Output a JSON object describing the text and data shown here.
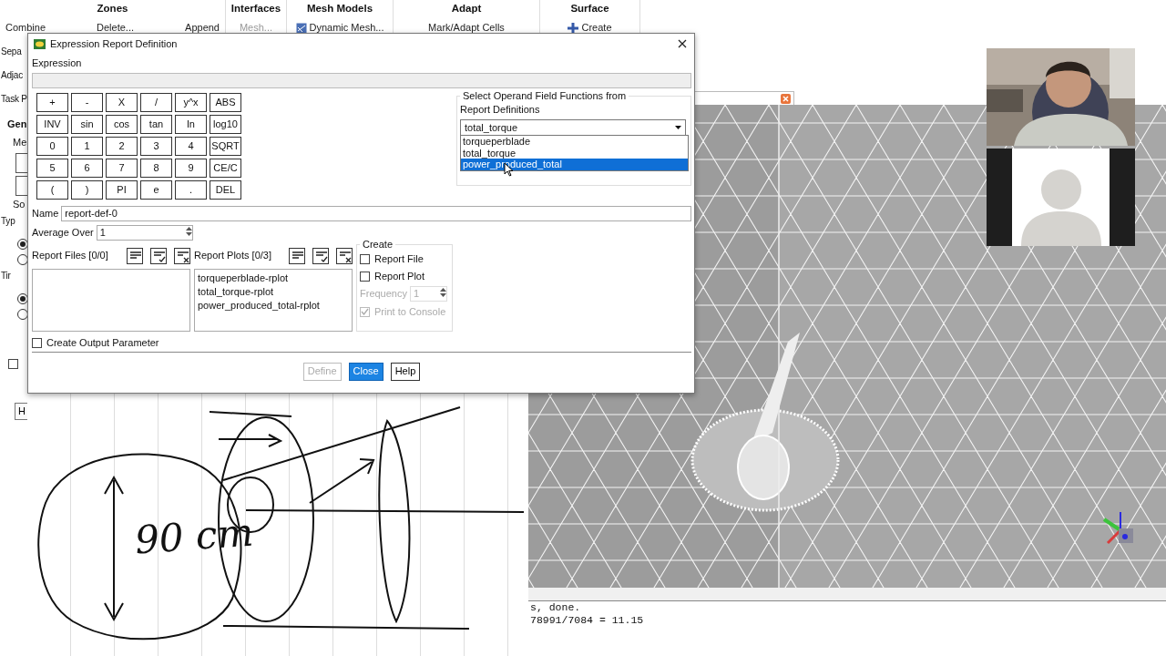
{
  "ribbon": {
    "groups": [
      {
        "title": "Zones",
        "items": [
          {
            "label": "Combine",
            "disabled": false
          },
          {
            "label": "Delete...",
            "disabled": false
          },
          {
            "label": "Append",
            "disabled": false
          }
        ]
      },
      {
        "title": "Interfaces",
        "items": [
          {
            "label": "Mesh...",
            "disabled": true
          }
        ]
      },
      {
        "title": "Mesh Models",
        "items": [
          {
            "label": "Dynamic Mesh...",
            "disabled": false,
            "kind": "mesh"
          }
        ]
      },
      {
        "title": "Adapt",
        "items": [
          {
            "label": "Mark/Adapt Cells",
            "disabled": false
          }
        ]
      },
      {
        "title": "Surface",
        "items": [
          {
            "label": "Create",
            "disabled": false,
            "kind": "plus"
          }
        ]
      }
    ]
  },
  "task_panel": {
    "items": [
      {
        "kind": "text",
        "label": "Sepa"
      },
      {
        "kind": "text",
        "label": "Adjac"
      },
      {
        "kind": "text",
        "label": "Task P"
      },
      {
        "kind": "heading",
        "label": "Gen"
      },
      {
        "kind": "group",
        "label": "Me"
      },
      {
        "kind": "box"
      },
      {
        "kind": "box"
      },
      {
        "kind": "group",
        "label": "So"
      },
      {
        "kind": "text",
        "label": "Typ"
      },
      {
        "kind": "radio",
        "selected": true
      },
      {
        "kind": "radio",
        "selected": false
      },
      {
        "kind": "text",
        "label": "Tir"
      },
      {
        "kind": "radio",
        "selected": true
      },
      {
        "kind": "radio",
        "selected": false
      },
      {
        "kind": "check",
        "checked": false
      },
      {
        "kind": "button",
        "label": "H"
      }
    ]
  },
  "dialog": {
    "title": "Expression Report Definition",
    "expression_label": "Expression",
    "keypad": [
      [
        "+",
        "-",
        "X",
        "/",
        "y^x",
        "ABS"
      ],
      [
        "INV",
        "sin",
        "cos",
        "tan",
        "ln",
        "log10"
      ],
      [
        "0",
        "1",
        "2",
        "3",
        "4",
        "SQRT"
      ],
      [
        "5",
        "6",
        "7",
        "8",
        "9",
        "CE/C"
      ],
      [
        "(",
        ")",
        "PI",
        "e",
        ".",
        "DEL"
      ]
    ],
    "operand": {
      "title": "Select Operand Field Functions from",
      "label": "Report Definitions",
      "value": "total_torque",
      "options": [
        {
          "label": "torqueperblade",
          "highlighted": false
        },
        {
          "label": "total_torque",
          "highlighted": false
        },
        {
          "label": "power_produced_total",
          "highlighted": true
        }
      ]
    },
    "name": {
      "label": "Name",
      "value": "report-def-0"
    },
    "average_over": {
      "label": "Average Over",
      "value": "1"
    },
    "report_files": {
      "label": "Report Files [0/0]"
    },
    "report_plots": {
      "label": "Report Plots [0/3]",
      "items": [
        "torqueperblade-rplot",
        "total_torque-rplot",
        "power_produced_total-rplot"
      ]
    },
    "create": {
      "title": "Create",
      "options": [
        {
          "label": "Report File",
          "checked": false
        },
        {
          "label": "Report Plot",
          "checked": false
        }
      ],
      "frequency": {
        "label": "Frequency",
        "value": "1",
        "disabled": true
      },
      "print_to_console": {
        "label": "Print to Console",
        "checked": true,
        "disabled": true
      }
    },
    "create_output_parameter": {
      "label": "Create Output Parameter",
      "checked": false
    },
    "buttons": [
      {
        "label": "Define",
        "kind": "disabled"
      },
      {
        "label": "Close",
        "kind": "primary"
      },
      {
        "label": "Help",
        "kind": "default"
      }
    ]
  },
  "console": {
    "lines": [
      "s, done.",
      "78991/7084 = 11.15"
    ]
  },
  "whiteboard": {
    "note": "90 cm"
  },
  "webcam": {
    "tiles": [
      {
        "kind": "video"
      },
      {
        "kind": "avatar"
      }
    ]
  }
}
